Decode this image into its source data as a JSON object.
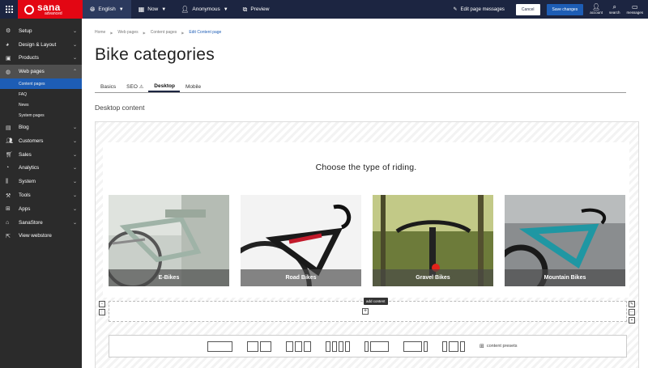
{
  "topbar": {
    "logo_main": "sana",
    "logo_sub": "advanced",
    "language": "English",
    "time": "Now",
    "user": "Anonymous",
    "preview": "Preview",
    "edit_messages": "Edit page messages",
    "cancel": "Cancel",
    "save": "Save changes",
    "account": "account",
    "search": "search",
    "messages": "messages"
  },
  "sidebar": {
    "items": [
      {
        "label": "Setup",
        "icon": "gear-icon"
      },
      {
        "label": "Design & Layout",
        "icon": "palette-icon"
      },
      {
        "label": "Products",
        "icon": "products-icon"
      },
      {
        "label": "Web pages",
        "icon": "globe-icon"
      },
      {
        "label": "Blog",
        "icon": "blog-icon"
      },
      {
        "label": "Customers",
        "icon": "customers-icon"
      },
      {
        "label": "Sales",
        "icon": "cart-icon"
      },
      {
        "label": "Analytics",
        "icon": "analytics-icon"
      },
      {
        "label": "System",
        "icon": "system-icon"
      },
      {
        "label": "Tools",
        "icon": "tools-icon"
      },
      {
        "label": "Apps",
        "icon": "apps-icon"
      },
      {
        "label": "SanaStore",
        "icon": "store-icon"
      },
      {
        "label": "View webstore",
        "icon": "external-icon"
      }
    ],
    "subitems": [
      "Content pages",
      "FAQ",
      "News",
      "System pages"
    ]
  },
  "breadcrumb": [
    "Home",
    "Web pages",
    "Content pages",
    "Edit Content page"
  ],
  "page_title": "Bike categories",
  "tabs": [
    "Basics",
    "SEO",
    "Desktop",
    "Mobile"
  ],
  "section_title": "Desktop content",
  "content": {
    "heading": "Choose the type of riding.",
    "cards": [
      "E-Bikes",
      "Road Bikes",
      "Gravel Bikes",
      "Mountain Bikes"
    ],
    "add_content": "add content",
    "presets": "content presets"
  },
  "colors": {
    "topbar": "#1c2541",
    "brand": "#e30613",
    "accent": "#1d5db5",
    "sidebar": "#2b2b2b"
  }
}
